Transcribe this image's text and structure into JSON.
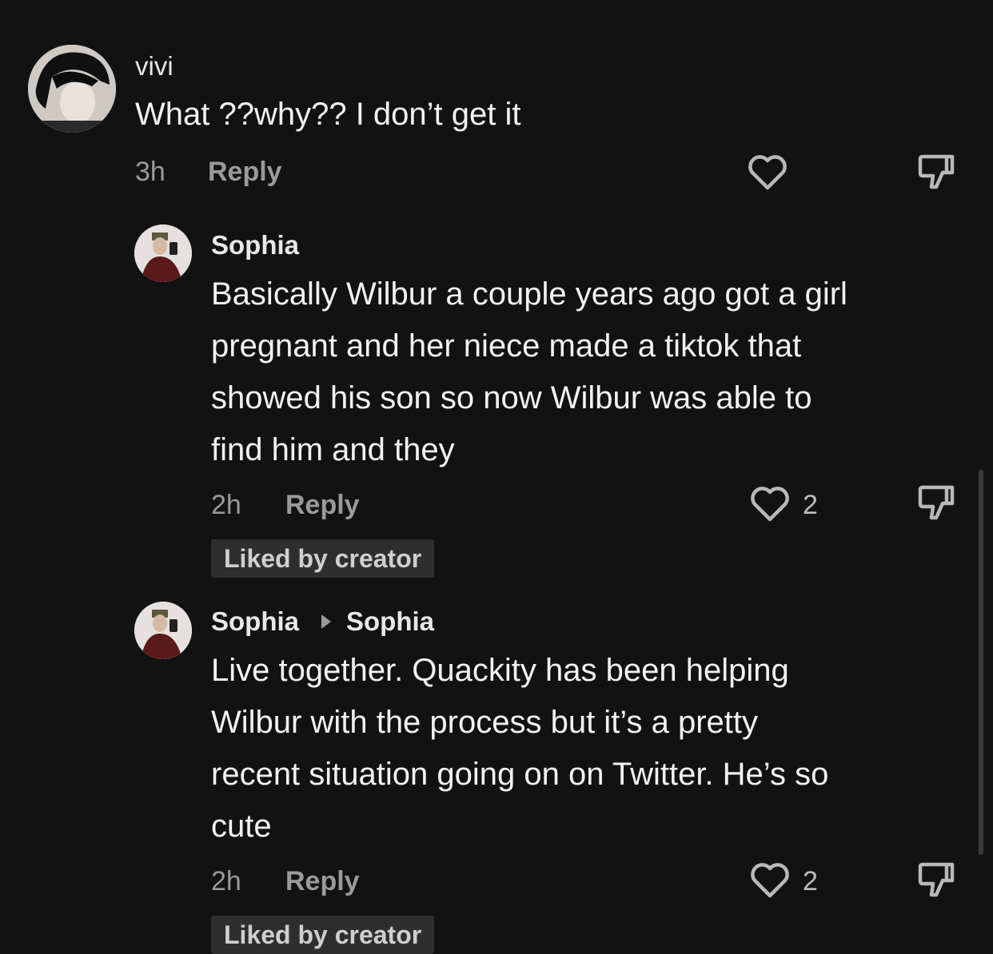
{
  "comments": [
    {
      "username": "vivi",
      "text": "What ??why?? I don’t get it",
      "time": "3h",
      "reply_label": "Reply",
      "likes": ""
    },
    {
      "username": "Sophia",
      "text_lines": [
        "Basically Wilbur a couple years ago got a girl",
        "pregnant and her niece made a tiktok that",
        "showed his son so now Wilbur was able to",
        "find him and they"
      ],
      "time": "2h",
      "reply_label": "Reply",
      "likes": "2",
      "badge": "Liked by creator"
    },
    {
      "username": "Sophia",
      "reply_to": "Sophia",
      "text_lines": [
        "Live together. Quackity has been helping",
        "Wilbur with the process but it’s a pretty",
        "recent situation going on on Twitter. He’s so",
        "cute"
      ],
      "time": "2h",
      "reply_label": "Reply",
      "likes": "2",
      "badge": "Liked by creator"
    }
  ],
  "icons": {
    "like": "heart-outline-icon",
    "dislike": "thumbs-down-icon",
    "reply_to": "caret-right-icon"
  },
  "colors": {
    "background": "#121212",
    "text": "#f2f2f2",
    "secondary": "#9a9a9a",
    "badge_bg": "#2e2e2e"
  }
}
